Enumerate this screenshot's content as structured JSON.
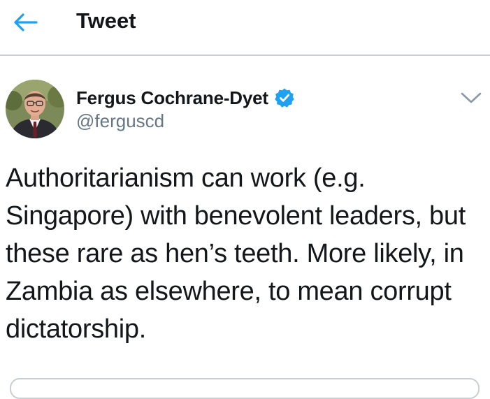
{
  "header": {
    "title": "Tweet",
    "back_icon": "arrow-left-icon"
  },
  "tweet": {
    "author": {
      "name": "Fergus Cochrane-Dyet",
      "handle": "@ferguscd",
      "verified": true,
      "verified_icon": "verified-badge-icon"
    },
    "menu_icon": "chevron-down-icon",
    "text": "Authoritarianism can work (e.g. Singapore) with benevolent leaders, but these rare as hen’s teeth. More likely, in Zambia as elsewhere, to mean corrupt dictatorship."
  },
  "colors": {
    "accent": "#1da1f2",
    "text": "#14171a",
    "secondary_text": "#657786",
    "divider": "#c9ced2"
  }
}
